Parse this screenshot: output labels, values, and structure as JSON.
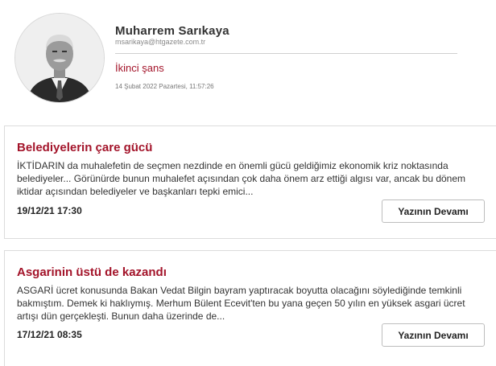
{
  "author": {
    "name": "Muharrem Sarıkaya",
    "email": "msarikaya@htgazete.com.tr",
    "headline": "İkinci şans",
    "date": "14 Şubat 2022 Pazartesi, 11:57:26"
  },
  "articles": [
    {
      "title": "Belediyelerin çare gücü",
      "excerpt": "İKTİDARIN da muhalefetin de seçmen nezdinde en önemli gücü geldiğimiz ekonomik kriz noktasında belediyeler... Görünürde bunun muhalefet açısından çok daha önem arz ettiği algısı var, ancak bu dönem iktidar açısından belediyeler ve başkanları tepki emici...",
      "date": "19/12/21 17:30",
      "button_label": "Yazının Devamı"
    },
    {
      "title": "Asgarinin üstü de kazandı",
      "excerpt": "ASGARİ ücret konusunda Bakan Vedat Bilgin bayram yaptıracak boyutta olacağını söylediğinde temkinli bakmıştım. Demek ki haklıymış. Merhum Bülent Ecevit'ten bu yana geçen 50 yılın en yüksek asgari ücret artışı dün gerçekleşti. Bunun daha üzerinde de...",
      "date": "17/12/21 08:35",
      "button_label": "Yazının Devamı"
    }
  ],
  "colors": {
    "accent": "#a3142a",
    "border": "#dcdcdc"
  },
  "icons": {
    "avatar": "author-portrait"
  }
}
